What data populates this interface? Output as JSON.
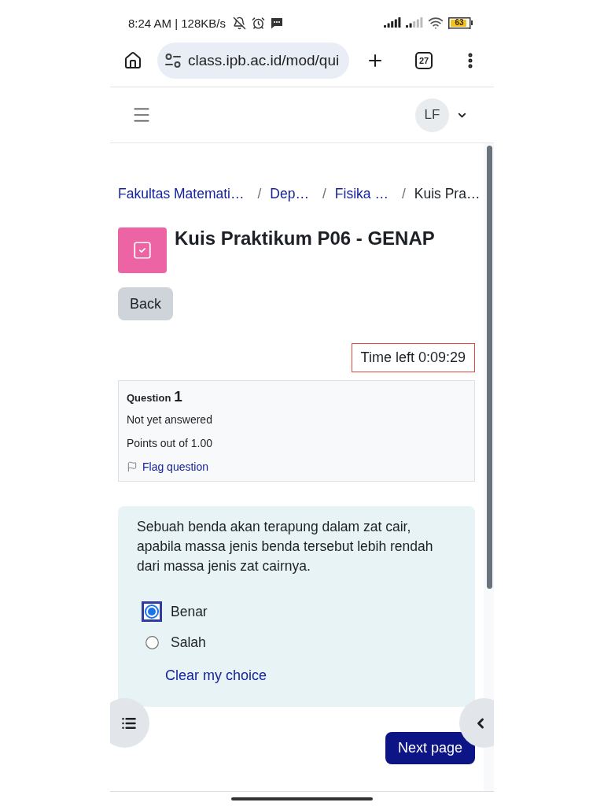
{
  "status_bar": {
    "text": "8:24 AM | 128KB/s",
    "battery": "63"
  },
  "browser_toolbar": {
    "url": "class.ipb.ac.id/mod/qui",
    "tab_count": "27"
  },
  "navbar": {
    "avatar_initials": "LF"
  },
  "breadcrumb": [
    {
      "label": "Fakultas Matemati…",
      "kind": "link"
    },
    {
      "label": "/",
      "kind": "separator"
    },
    {
      "label": "Dep…",
      "kind": "link"
    },
    {
      "label": "/",
      "kind": "separator"
    },
    {
      "label": "Fisika …",
      "kind": "link"
    },
    {
      "label": "/",
      "kind": "separator"
    },
    {
      "label": "Kuis Pra…",
      "kind": "current"
    }
  ],
  "header": {
    "title": "Kuis Praktikum P06 - GENAP",
    "back_button": "Back"
  },
  "timer": "Time left 0:09:29",
  "question_info": {
    "label": "Question",
    "number": "1",
    "status": "Not yet answered",
    "points": "Points out of 1.00",
    "flag_link": "Flag question",
    "flagged": false
  },
  "question": {
    "text": "Sebuah benda akan terapung dalam zat cair, apabila massa jenis benda tersebut lebih rendah dari massa jenis zat cairnya.",
    "options": [
      {
        "label": "Benar",
        "selected": true
      },
      {
        "label": "Salah",
        "selected": false
      }
    ],
    "clear_link": "Clear my choice"
  },
  "next_button": "Next page"
}
